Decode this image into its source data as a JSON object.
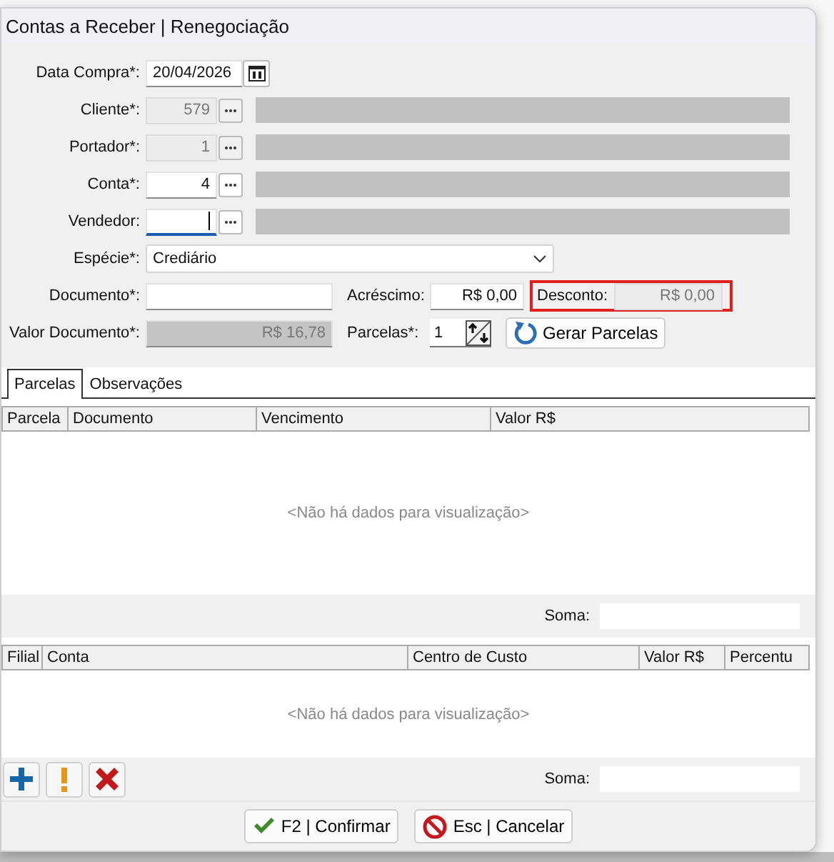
{
  "window": {
    "title": "Contas a Receber | Renegociação"
  },
  "purchase_date": {
    "label": "Data Compra*:",
    "value": "20/04/2026"
  },
  "lookup_fields": [
    {
      "label": "Cliente*:",
      "value": "579",
      "disabled": true,
      "focused": false
    },
    {
      "label": "Portador*:",
      "value": "1",
      "disabled": true,
      "focused": false
    },
    {
      "label": "Conta*:",
      "value": "4",
      "disabled": false,
      "focused": false
    },
    {
      "label": "Vendedor:",
      "disabled": false,
      "focused": true
    }
  ],
  "species": {
    "label": "Espécie*:",
    "value": "Crediário"
  },
  "document": {
    "label": "Documento*:"
  },
  "surcharge": {
    "label": "Acréscimo:",
    "value": "R$ 0,00"
  },
  "discount": {
    "label": "Desconto:",
    "value": "R$ 0,00",
    "highlighted": true
  },
  "document_value": {
    "label": "Valor Documento*:",
    "value": "R$ 16,78"
  },
  "installments": {
    "label": "Parcelas*:",
    "value": "1"
  },
  "generate_button": {
    "label": "Gerar Parcelas"
  },
  "tabs": [
    {
      "label": "Parcelas",
      "selected": true
    },
    {
      "label": "Observações",
      "selected": false
    }
  ],
  "installments_grid": {
    "columns": [
      "Parcela",
      "Documento",
      "Vencimento",
      "Valor R$"
    ],
    "empty_message": "<Não há dados para visualização>",
    "sum_label": "Soma:"
  },
  "allocation_grid": {
    "columns": [
      "Filial",
      "Conta",
      "Centro de Custo",
      "Valor R$",
      "Percentu"
    ],
    "empty_message": "<Não há dados para visualização>",
    "sum_label": "Soma:"
  },
  "toolbar": [
    {
      "kind": "add"
    },
    {
      "kind": "warning"
    },
    {
      "kind": "delete"
    }
  ],
  "footer_buttons": [
    {
      "kind": "confirm",
      "label": "F2 | Confirmar"
    },
    {
      "kind": "cancel",
      "label": "Esc | Cancelar"
    }
  ]
}
